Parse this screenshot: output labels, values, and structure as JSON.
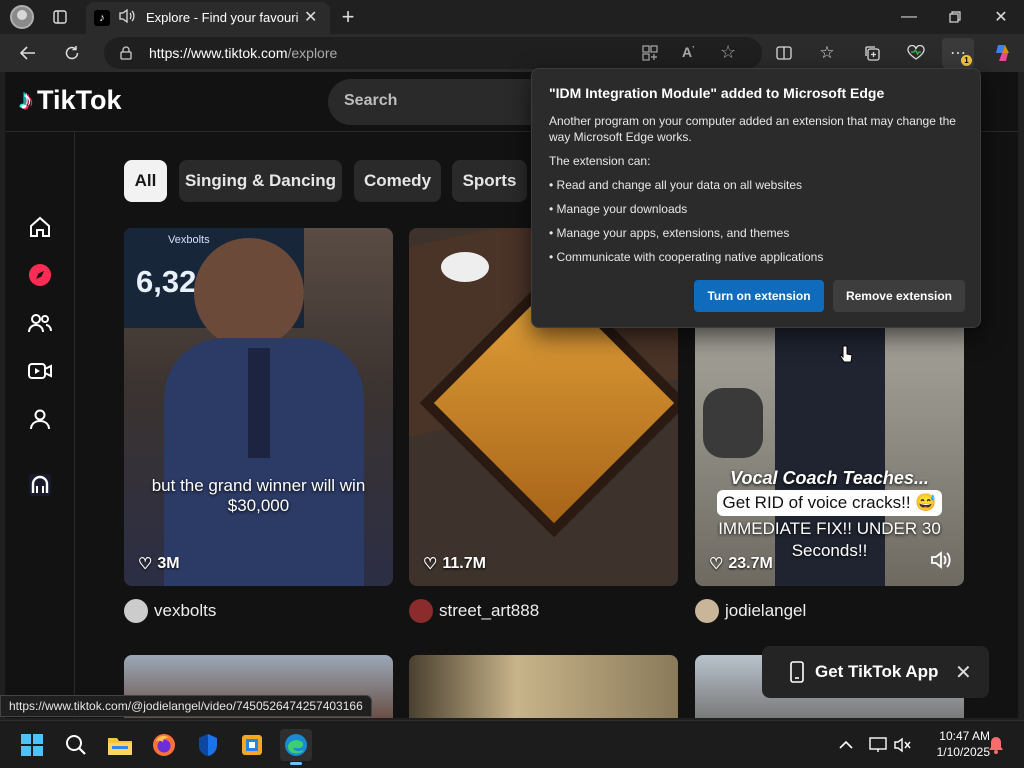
{
  "browser": {
    "tab_title": "Explore - Find your favourite",
    "url_host": "https://www.tiktok.com",
    "url_path": "/explore",
    "notification_badge": "1"
  },
  "tiktok": {
    "logo_text": "TikTok",
    "search_placeholder": "Search",
    "chips": [
      "All",
      "Singing & Dancing",
      "Comedy",
      "Sports"
    ],
    "videos": [
      {
        "caption_line1": "but the grand winner will win",
        "caption_line2": "$30,000",
        "likes": "3M",
        "user": "vexbolts",
        "screen_text": "6,326,0",
        "screen_label": "Vexbolts"
      },
      {
        "likes": "11.7M",
        "user": "street_art888"
      },
      {
        "overlay_title": "Vocal Coach Teaches...",
        "overlay_banner": "Get RID of voice cracks!! 😅",
        "overlay_caption": "IMMEDIATE FIX!! UNDER 30 Seconds!!",
        "likes": "23.7M",
        "user": "jodielangel"
      }
    ],
    "get_app_label": "Get TikTok App"
  },
  "popup": {
    "title": "\"IDM Integration Module\" added to Microsoft Edge",
    "description": "Another program on your computer added an extension that may change the way Microsoft Edge works.",
    "can_label": "The extension can:",
    "permissions": [
      "• Read and change all your data on all websites",
      "• Manage your downloads",
      "• Manage your apps, extensions, and themes",
      "• Communicate with cooperating native applications"
    ],
    "primary_button": "Turn on extension",
    "secondary_button": "Remove extension"
  },
  "status_url": "https://www.tiktok.com/@jodielangel/video/7450526474257403166",
  "taskbar": {
    "time": "10:47 AM",
    "date": "1/10/2025"
  },
  "colors": {
    "accent_blue": "#0f6cbd",
    "tiktok_red": "#fe2c55",
    "dark_bg": "#121212"
  }
}
